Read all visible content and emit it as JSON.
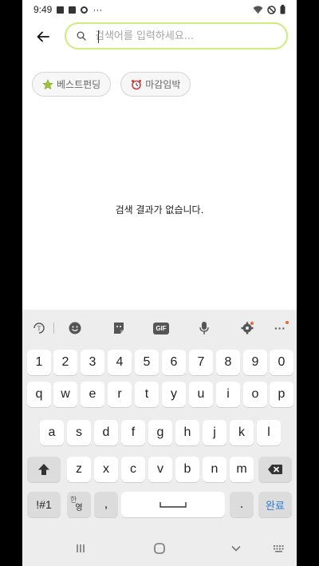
{
  "status_bar": {
    "time": "9:49",
    "dots": "···"
  },
  "search": {
    "placeholder": "검색어를 입력하세요..."
  },
  "chips": [
    {
      "label": "베스트펀딩",
      "icon": "star-icon"
    },
    {
      "label": "마감임박",
      "icon": "alarm-clock-icon"
    }
  ],
  "empty_message": "검색 결과가 없습니다.",
  "keyboard": {
    "toolbar": {
      "gif_label": "GIF",
      "more": "···"
    },
    "row_numbers": [
      "1",
      "2",
      "3",
      "4",
      "5",
      "6",
      "7",
      "8",
      "9",
      "0"
    ],
    "row_q": [
      "q",
      "w",
      "e",
      "r",
      "t",
      "y",
      "u",
      "i",
      "o",
      "p"
    ],
    "row_a": [
      "a",
      "s",
      "d",
      "f",
      "g",
      "h",
      "j",
      "k",
      "l"
    ],
    "row_z": [
      "z",
      "x",
      "c",
      "v",
      "b",
      "n",
      "m"
    ],
    "symbols_label": "!#1",
    "lang_top": "한",
    "lang_bottom": "영",
    "comma_label": ",",
    "period_label": ".",
    "done_label": "완료"
  },
  "colors": {
    "search_border": "#c9ee7a",
    "done_text": "#2a7bd5",
    "background": "#000000"
  }
}
